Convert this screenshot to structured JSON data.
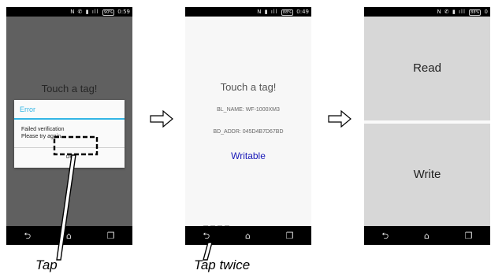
{
  "phones": [
    {
      "status_icons": "N ✆ ▮ ıll",
      "status_battery": "90%",
      "status_time": "0:59",
      "background_text": "Touch a tag!",
      "dialog": {
        "title": "Error",
        "message_line1": "Failed verification",
        "message_line2": "Please try again.",
        "ok_label": "OK"
      }
    },
    {
      "status_icons": "N ▮ ıll",
      "status_battery": "88%",
      "status_time": "0:49",
      "title": "Touch a tag!",
      "bl_name": "BL_NAME: WF-1000XM3",
      "bd_addr": "BD_ADDR: 045D4B7D67BD",
      "status": "Writable"
    },
    {
      "status_icons": "N ✆ ▮ ıll",
      "status_battery": "88%",
      "status_time": "0",
      "read_label": "Read",
      "write_label": "Write"
    }
  ],
  "navbar": {
    "back_icon": "back-icon",
    "home_icon": "home-icon",
    "recents_icon": "recents-icon"
  },
  "captions": {
    "first": "Tap",
    "second": "Tap twice"
  },
  "colors": {
    "dialog_accent": "#33b5e5",
    "writable_text": "#1a1ab8",
    "dim_background": "#606060"
  }
}
